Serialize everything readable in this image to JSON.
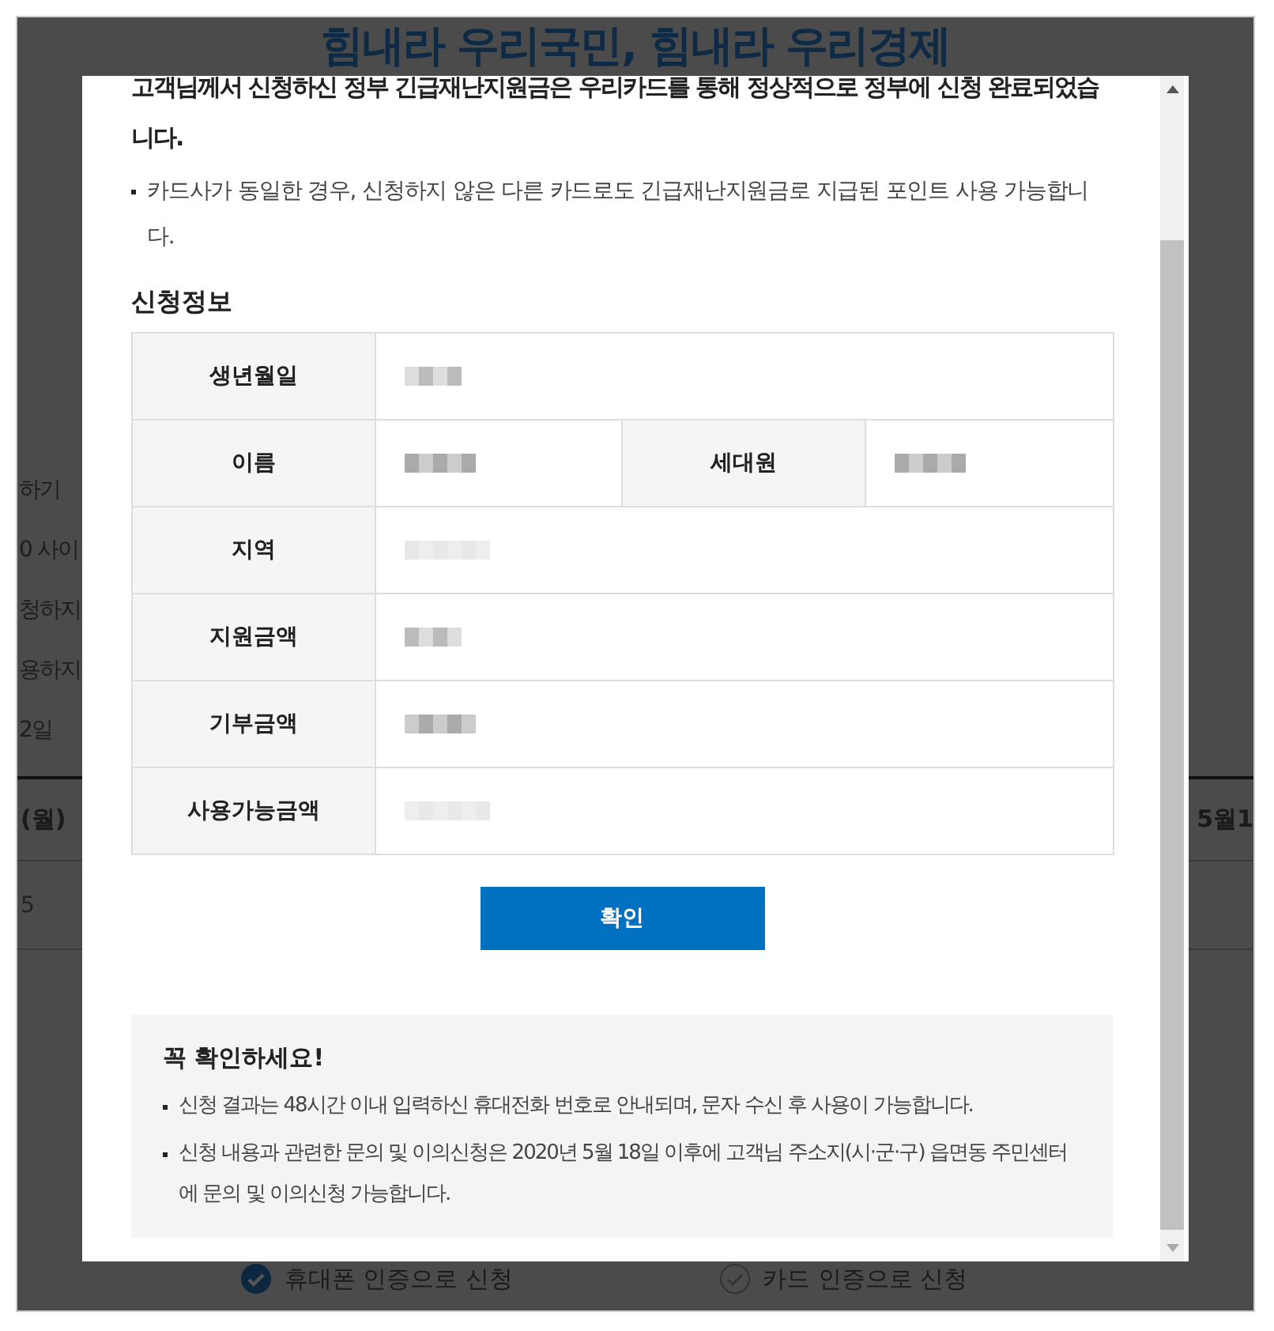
{
  "background_page": {
    "title": "힘내라 우리국민, 힘내라 우리경제",
    "left_fragments": [
      "하기",
      "0 사이",
      "청하지",
      "용하지",
      "2일"
    ],
    "table_header": [
      "(월)",
      "5월1"
    ],
    "table_cell": "5",
    "options": [
      {
        "label": "휴대폰 인증으로 신청",
        "selected": true
      },
      {
        "label": "카드 인증으로 신청",
        "selected": false
      }
    ]
  },
  "dialog": {
    "message": "고객님께서 신청하신 정부 긴급재난지원금은 우리카드를 통해 정상적으로 정부에 신청 완료되었습니다.",
    "note": "카드사가 동일한 경우, 신청하지 않은 다른 카드로도 긴급재난지원금로 지급된 포인트 사용 가능합니다.",
    "section_title": "신청정보",
    "info_rows": [
      [
        {
          "label": "생년월일",
          "redacted": true
        }
      ],
      [
        {
          "label": "이름",
          "redacted": true
        },
        {
          "label": "세대원",
          "redacted": true
        }
      ],
      [
        {
          "label": "지역",
          "redacted": true
        }
      ],
      [
        {
          "label": "지원금액",
          "redacted": true
        }
      ],
      [
        {
          "label": "기부금액",
          "redacted": true
        }
      ],
      [
        {
          "label": "사용가능금액",
          "redacted": true
        }
      ]
    ],
    "confirm_button": "확인",
    "notice": {
      "title": "꼭 확인하세요!",
      "items": [
        "신청 결과는 48시간 이내 입력하신 휴대전화 번호로 안내되며, 문자 수신 후 사용이 가능합니다.",
        "신청 내용과 관련한 문의 및 이의신청은 2020년 5월 18일 이후에 고객님 주소지(시·군·구) 읍면동 주민센터에 문의 및 이의신청 가능합니다."
      ]
    }
  }
}
